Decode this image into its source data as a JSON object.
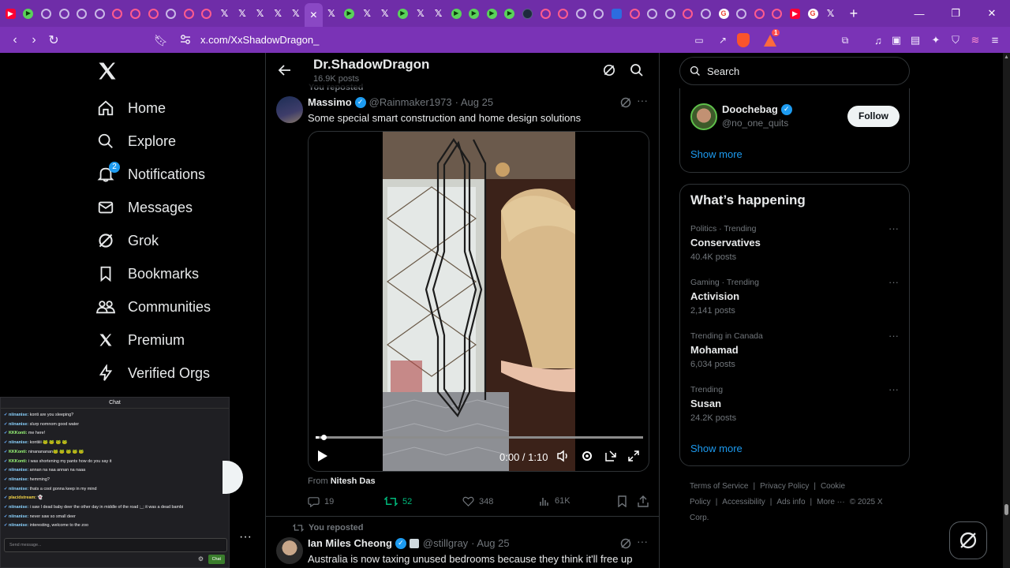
{
  "browser": {
    "tabs": [
      {
        "icon": "yt",
        "glyph": "▶"
      },
      {
        "icon": "play",
        "glyph": "▶"
      },
      {
        "icon": "ring",
        "glyph": ""
      },
      {
        "icon": "ring",
        "glyph": ""
      },
      {
        "icon": "ring",
        "glyph": ""
      },
      {
        "icon": "ring",
        "glyph": ""
      },
      {
        "icon": "pink",
        "glyph": ""
      },
      {
        "icon": "pink",
        "glyph": ""
      },
      {
        "icon": "pink",
        "glyph": ""
      },
      {
        "icon": "ring",
        "glyph": ""
      },
      {
        "icon": "pink",
        "glyph": ""
      },
      {
        "icon": "pink",
        "glyph": ""
      },
      {
        "icon": "xx",
        "glyph": "𝕏"
      },
      {
        "icon": "xx",
        "glyph": "𝕏"
      },
      {
        "icon": "xx",
        "glyph": "𝕏"
      },
      {
        "icon": "xx",
        "glyph": "𝕏"
      },
      {
        "icon": "xx",
        "glyph": "𝕏"
      },
      {
        "icon": "xx",
        "glyph": "✕",
        "active": true
      },
      {
        "icon": "xx",
        "glyph": "𝕏"
      },
      {
        "icon": "play",
        "glyph": "▶"
      },
      {
        "icon": "xx",
        "glyph": "𝕏"
      },
      {
        "icon": "xx",
        "glyph": "𝕏"
      },
      {
        "icon": "play",
        "glyph": "▶"
      },
      {
        "icon": "xx",
        "glyph": "𝕏"
      },
      {
        "icon": "xx",
        "glyph": "𝕏"
      },
      {
        "icon": "play",
        "glyph": "▶"
      },
      {
        "icon": "play",
        "glyph": "▶"
      },
      {
        "icon": "play",
        "glyph": "▶"
      },
      {
        "icon": "play",
        "glyph": "▶"
      },
      {
        "icon": "dark",
        "glyph": ""
      },
      {
        "icon": "pink",
        "glyph": ""
      },
      {
        "icon": "pink",
        "glyph": ""
      },
      {
        "icon": "ring",
        "glyph": ""
      },
      {
        "icon": "ring",
        "glyph": ""
      },
      {
        "icon": "blue",
        "glyph": ""
      },
      {
        "icon": "pink",
        "glyph": ""
      },
      {
        "icon": "ring",
        "glyph": ""
      },
      {
        "icon": "ring",
        "glyph": ""
      },
      {
        "icon": "pink",
        "glyph": ""
      },
      {
        "icon": "ring",
        "glyph": ""
      },
      {
        "icon": "g",
        "glyph": "G"
      },
      {
        "icon": "ring",
        "glyph": ""
      },
      {
        "icon": "pink",
        "glyph": ""
      },
      {
        "icon": "pink",
        "glyph": ""
      },
      {
        "icon": "yt",
        "glyph": "▶"
      },
      {
        "icon": "g",
        "glyph": "G"
      },
      {
        "icon": "xx",
        "glyph": "𝕏"
      }
    ],
    "url": "x.com/XxShadowDragon_",
    "rewards_count": "1",
    "accent": "#7a33b6"
  },
  "nav": {
    "items": [
      {
        "label": "Home",
        "icon": "home-icon"
      },
      {
        "label": "Explore",
        "icon": "search-icon"
      },
      {
        "label": "Notifications",
        "icon": "bell-icon",
        "badge": "2"
      },
      {
        "label": "Messages",
        "icon": "mail-icon"
      },
      {
        "label": "Grok",
        "icon": "grok-icon"
      },
      {
        "label": "Bookmarks",
        "icon": "bookmark-icon"
      },
      {
        "label": "Communities",
        "icon": "people-icon"
      },
      {
        "label": "Premium",
        "icon": "x-icon"
      },
      {
        "label": "Verified Orgs",
        "icon": "bolt-icon"
      }
    ]
  },
  "chat": {
    "title": "Chat",
    "lines": [
      {
        "user": "niinanise:",
        "msg": " konti are you sleeping?",
        "color": "u"
      },
      {
        "user": "niinanise:",
        "msg": " slurp nomnom good water",
        "color": "u"
      },
      {
        "user": "KKKonti:",
        "msg": " me here!",
        "color": "g"
      },
      {
        "user": "niinanise:",
        "msg": " kontiiii 🐸 🐸 🐸 🐸",
        "color": "u"
      },
      {
        "user": "KKKonti:",
        "msg": " ninanananan🐸 🐸 🐸 🐸 🐸",
        "color": "g"
      },
      {
        "user": "KKKonti:",
        "msg": " i was shortening my pants how do you say it",
        "color": "g"
      },
      {
        "user": "niinanise:",
        "msg": " annan na naa annan na naaa",
        "color": "u"
      },
      {
        "user": "niinanise:",
        "msg": " hemming?",
        "color": "u"
      },
      {
        "user": "niinanise:",
        "msg": " thats a cool gonna keep in my mind",
        "color": "u"
      },
      {
        "user": "placidstream:",
        "msg": " 👻",
        "color": "y"
      },
      {
        "user": "niinanise:",
        "msg": " i saw I dead baby deer the other day in middle of the road ;_; it was a dead bambi",
        "color": "u"
      },
      {
        "user": "niinanise:",
        "msg": " never saw so small deer",
        "color": "u"
      },
      {
        "user": "niinanise:",
        "msg": " interesting, welcome to the zoo",
        "color": "u"
      }
    ],
    "input_placeholder": "Send message...",
    "send_label": "Chat"
  },
  "profile": {
    "name": "Dr.ShadowDragon",
    "posts_count": "16.9K posts",
    "reposted_label": "You reposted"
  },
  "post1": {
    "author": "Massimo",
    "handle": "@Rainmaker1973",
    "date": "· Aug 25",
    "text": "Some special smart construction and home design solutions",
    "video_time": "0:00 / 1:10",
    "video_progress_fraction": 0.01,
    "from_label": "From",
    "from_name": "Nitesh Das",
    "replies": "19",
    "reposts": "52",
    "likes": "348",
    "views": "61K"
  },
  "post2": {
    "reposted_label": "You reposted",
    "author": "Ian Miles Cheong",
    "handle": "@stillgray",
    "date": "· Aug 25",
    "text": "Australia is now taxing unused bedrooms because they think it'll free up"
  },
  "right": {
    "search_placeholder": "Search",
    "who_to_follow": {
      "name": "Doochebag",
      "handle": "@no_one_quits",
      "follow_label": "Follow",
      "show_more": "Show more"
    },
    "whats_happening": {
      "title": "What’s happening",
      "trends": [
        {
          "category": "Politics · Trending",
          "name": "Conservatives",
          "count": "40.4K posts"
        },
        {
          "category": "Gaming · Trending",
          "name": "Activision",
          "count": "2,141 posts"
        },
        {
          "category": "Trending in Canada",
          "name": "Mohamad",
          "count": "6,034 posts"
        },
        {
          "category": "Trending",
          "name": "Susan",
          "count": "24.2K posts"
        }
      ],
      "show_more": "Show more"
    },
    "footer": {
      "links": [
        "Terms of Service",
        "|",
        "Privacy Policy",
        "|",
        "Cookie Policy",
        "|",
        "Accessibility",
        "|",
        "Ads info",
        "|",
        "More ···",
        "© 2025 X Corp."
      ]
    }
  }
}
